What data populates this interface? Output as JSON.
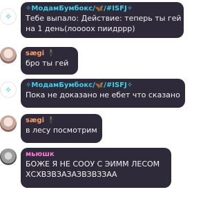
{
  "messages": [
    {
      "sender": "✧МодамБумбокс/🦋/#ISFJ✧",
      "text_line1": "Тебе выпало: Действие: теперь ты гей",
      "text_line2": "на 1 день(лоооох пиидррр)",
      "avatar": "bot-sparkle-icon"
    },
    {
      "sender": "sægi 🕴",
      "text_line1": "бро ты гей",
      "avatar": "user-photo"
    },
    {
      "sender": "✧МодамБумбокс/🦋/#ISFJ✧",
      "text_line1": "Пока не доказано не ебет что сказано",
      "avatar": "bot-sparkle-icon"
    },
    {
      "sender": "sægi 🕴",
      "text_line1": "в лесу посмотрим",
      "avatar": "user-photo"
    },
    {
      "sender": "мьюшк",
      "text_line1": "БОЖЕ Я НЕ СООУ С ЭИММ ЛЕСОМ",
      "text_line2": "ХСХВЗВЗАЗАЗВЗВЗЗАА",
      "avatar": "user-photo"
    }
  ],
  "colors": {
    "bubble": "#2e2a3a",
    "bot_name": "#3ed0e8",
    "saegi_name": "#ff9f6a",
    "myushk_name": "#ff7ad6"
  }
}
